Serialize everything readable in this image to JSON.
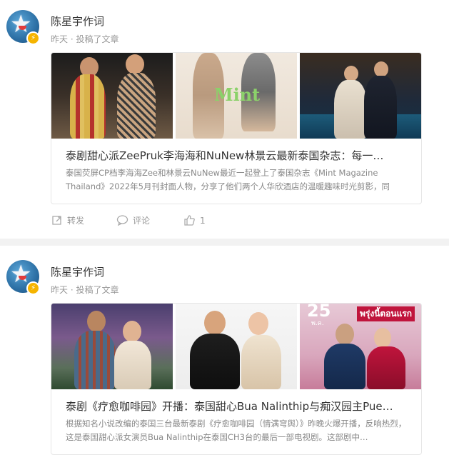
{
  "posts": [
    {
      "author": "陈星宇作词",
      "meta": "昨天 · 投稿了文章",
      "title": "泰剧甜心派ZeePruk李海海和NuNew林景云最新泰国杂志：每一…",
      "desc": "泰国荧屏CP档李海海Zee和林景云NuNew最近一起登上了泰国杂志《Mint Magazine Thailand》2022年5月刊封面人物，分享了他们两个人华欣酒店的温暖趣味时光剪影，同时，…",
      "magazine_logo": "Mint",
      "actions": {
        "repost": "转发",
        "comment": "评论",
        "like_count": "1"
      }
    },
    {
      "author": "陈星宇作词",
      "meta": "昨天 · 投稿了文章",
      "title": "泰剧《疗愈咖啡园》开播：泰国甜心Bua Nalinthip与痴汉园主Pue…",
      "desc": "根据知名小说改编的泰国三台最新泰剧《疗愈咖啡园（情满穹舆）》昨晚火爆开播，反响热烈，这是泰国甜心派女演员Bua Nalinthip在泰国CH3台的最后一部电视剧。这部剧中…",
      "poster_date": "25",
      "poster_month": "พ.ค.",
      "poster_thai_title": "พรุ่งนี้ตอนแรก"
    }
  ]
}
